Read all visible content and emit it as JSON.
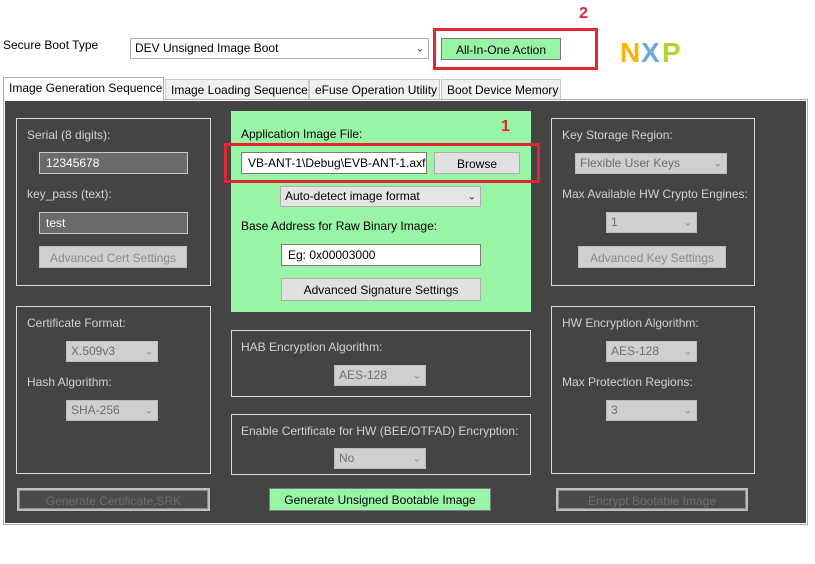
{
  "header": {
    "boot_type_label": "Secure Boot Type",
    "boot_type_value": "DEV Unsigned Image Boot",
    "all_in_one_button": "All-In-One Action",
    "logo_text": "NXP"
  },
  "annotations": {
    "marker_1": "1",
    "marker_2": "2"
  },
  "tabs": [
    {
      "label": "Image Generation Sequence",
      "active": true
    },
    {
      "label": "Image Loading Sequence",
      "active": false
    },
    {
      "label": "eFuse Operation Utility",
      "active": false
    },
    {
      "label": "Boot Device Memory",
      "active": false
    }
  ],
  "left_top": {
    "serial_label": "Serial (8 digits):",
    "serial_value": "12345678",
    "keypass_label": "key_pass (text):",
    "keypass_value": "test",
    "advanced_cert_button": "Advanced Cert Settings"
  },
  "left_bottom": {
    "cert_format_label": "Certificate Format:",
    "cert_format_value": "X.509v3",
    "hash_alg_label": "Hash Algorithm:",
    "hash_alg_value": "SHA-256"
  },
  "center_top": {
    "app_image_label": "Application Image File:",
    "app_image_value": "VB-ANT-1\\Debug\\EVB-ANT-1.axf",
    "browse_button": "Browse",
    "image_format_value": "Auto-detect image format",
    "base_address_label": "Base Address for Raw Binary Image:",
    "base_address_placeholder": "Eg: 0x00003000",
    "advanced_sig_button": "Advanced Signature Settings"
  },
  "center_mid": {
    "hab_enc_label": "HAB Encryption Algorithm:",
    "hab_enc_value": "AES-128"
  },
  "center_bottom": {
    "enable_cert_label": "Enable Certificate for HW (BEE/OTFAD) Encryption:",
    "enable_cert_value": "No"
  },
  "right_top": {
    "key_storage_label": "Key Storage Region:",
    "key_storage_value": "Flexible User Keys",
    "max_engines_label": "Max Available HW Crypto Engines:",
    "max_engines_value": "1",
    "advanced_key_button": "Advanced Key Settings"
  },
  "right_bottom": {
    "hw_enc_label": "HW Encryption Algorithm:",
    "hw_enc_value": "AES-128",
    "max_regions_label": "Max Protection Regions:",
    "max_regions_value": "3"
  },
  "bottom_buttons": {
    "gen_cert": "Generate Certificate,SRK",
    "gen_unsigned": "Generate Unsigned Bootable Image",
    "encrypt": "Encrypt Bootable Image"
  },
  "colors": {
    "accent_green": "#99f5a6",
    "panel_dark": "#444444",
    "annotation_red": "#e0262e",
    "nxp_yellow": "#f9b500",
    "nxp_blue": "#6fa8dc",
    "nxp_green": "#b5d334"
  }
}
